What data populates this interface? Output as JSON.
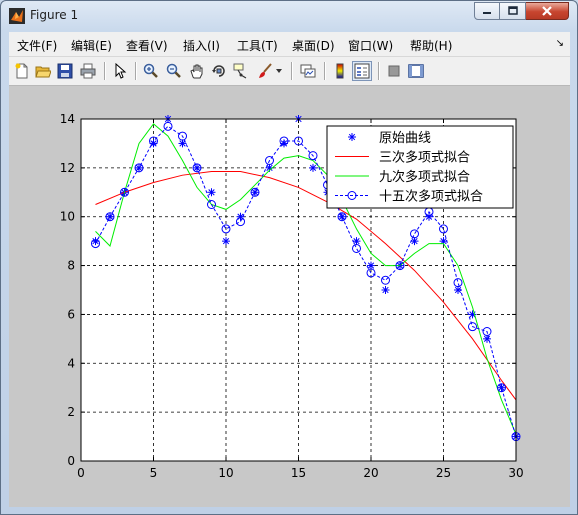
{
  "window": {
    "title": "Figure 1"
  },
  "menu": [
    {
      "label": "文件(F)"
    },
    {
      "label": "编辑(E)"
    },
    {
      "label": "查看(V)"
    },
    {
      "label": "插入(I)"
    },
    {
      "label": "工具(T)"
    },
    {
      "label": "桌面(D)"
    },
    {
      "label": "窗口(W)"
    },
    {
      "label": "帮助(H)"
    }
  ],
  "toolbar": [
    {
      "icon": "new-figure-icon"
    },
    {
      "icon": "open-file-icon"
    },
    {
      "icon": "save-icon"
    },
    {
      "icon": "print-icon"
    },
    {
      "icon": "edit-plot-arrow-icon"
    },
    {
      "icon": "zoom-in-icon"
    },
    {
      "icon": "zoom-out-icon"
    },
    {
      "icon": "pan-hand-icon"
    },
    {
      "icon": "rotate-3d-icon"
    },
    {
      "icon": "data-cursor-icon"
    },
    {
      "icon": "brush-icon"
    },
    {
      "icon": "link-plot-icon"
    },
    {
      "icon": "insert-colorbar-icon"
    },
    {
      "icon": "insert-legend-icon"
    },
    {
      "icon": "hide-plot-tools-icon"
    },
    {
      "icon": "show-plot-tools-icon"
    }
  ],
  "chart_data": {
    "type": "line",
    "xlim": [
      0,
      30
    ],
    "ylim": [
      0,
      14
    ],
    "xticks": [
      0,
      5,
      10,
      15,
      20,
      25,
      30
    ],
    "yticks": [
      0,
      2,
      4,
      6,
      8,
      10,
      12,
      14
    ],
    "grid": "on",
    "legend_position": "top-right",
    "series": [
      {
        "name": "原始曲线",
        "style": "markers-star",
        "color": "#0000ff",
        "x": [
          1,
          2,
          3,
          4,
          5,
          6,
          7,
          8,
          9,
          10,
          11,
          12,
          13,
          14,
          15,
          16,
          17,
          18,
          19,
          20,
          21,
          22,
          23,
          24,
          25,
          26,
          27,
          28,
          29,
          30
        ],
        "y": [
          9,
          10,
          11,
          12,
          13,
          14,
          13,
          12,
          11,
          9,
          10,
          11,
          12,
          13,
          14,
          12,
          11,
          10,
          9,
          8,
          7,
          8,
          9,
          10,
          9,
          7,
          6,
          5,
          3,
          1
        ]
      },
      {
        "name": "三次多项式拟合",
        "style": "line",
        "color": "#ff0000",
        "x": [
          1,
          3,
          5,
          7,
          9,
          11,
          13,
          15,
          17,
          19,
          21,
          23,
          25,
          27,
          29,
          30
        ],
        "y": [
          10.5,
          11.0,
          11.4,
          11.7,
          11.85,
          11.85,
          11.6,
          11.2,
          10.6,
          9.9,
          8.9,
          7.8,
          6.5,
          5.0,
          3.3,
          2.5
        ]
      },
      {
        "name": "九次多项式拟合",
        "style": "line",
        "color": "#00ee00",
        "x": [
          1,
          2,
          3,
          4,
          5,
          6,
          7,
          8,
          9,
          10,
          11,
          12,
          13,
          14,
          15,
          16,
          17,
          18,
          19,
          20,
          21,
          22,
          23,
          24,
          25,
          26,
          27,
          28,
          29,
          30
        ],
        "y": [
          9.4,
          8.8,
          11.0,
          13.0,
          13.8,
          13.3,
          12.3,
          11.2,
          10.5,
          10.3,
          10.7,
          11.3,
          11.9,
          12.4,
          12.5,
          12.3,
          11.7,
          10.7,
          9.5,
          8.5,
          8.0,
          8.0,
          8.5,
          8.9,
          8.9,
          8.0,
          6.3,
          4.2,
          2.5,
          1.1
        ]
      },
      {
        "name": "十五次多项式拟合",
        "style": "dashed-circles",
        "color": "#0000ff",
        "x": [
          1,
          2,
          3,
          4,
          5,
          6,
          7,
          8,
          9,
          10,
          11,
          12,
          13,
          14,
          15,
          16,
          17,
          18,
          19,
          20,
          21,
          22,
          23,
          24,
          25,
          26,
          27,
          28,
          29,
          30
        ],
        "y": [
          8.9,
          10.0,
          11.0,
          12.0,
          13.1,
          13.7,
          13.3,
          12.0,
          10.5,
          9.5,
          9.8,
          11.0,
          12.3,
          13.1,
          13.1,
          12.5,
          11.3,
          10.0,
          8.7,
          7.7,
          7.4,
          8.0,
          9.3,
          10.2,
          9.5,
          7.3,
          5.5,
          5.3,
          3.0,
          1.0
        ]
      }
    ]
  }
}
